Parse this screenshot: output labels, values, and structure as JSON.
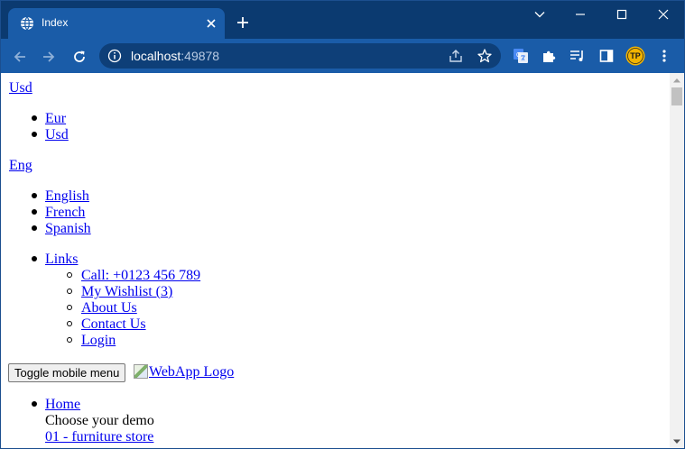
{
  "browser": {
    "tab": {
      "title": "Index",
      "icon": "globe-icon"
    },
    "omnibox": {
      "host": "localhost",
      "port": ":49878"
    },
    "profile_initials": "TP",
    "colors": {
      "frame": "#0b3a70",
      "tab_active": "#1a5ca8",
      "toolbar": "#1a5ca8",
      "omnibox": "#0e3f78",
      "avatar": "#f2b400",
      "link": "#0000ee"
    }
  },
  "page": {
    "currency": {
      "current": "Usd",
      "options": [
        "Eur",
        "Usd"
      ]
    },
    "language": {
      "current": "Eng",
      "options": [
        "English",
        "French",
        "Spanish"
      ]
    },
    "links_menu": {
      "label": "Links",
      "items": [
        "Call: +0123 456 789",
        "My Wishlist (3)",
        "About Us",
        "Contact Us",
        "Login"
      ]
    },
    "toggle_mobile_label": "Toggle mobile menu",
    "logo_alt": "WebApp Logo",
    "nav": {
      "home_label": "Home",
      "demo_heading": "Choose your demo",
      "demo_first": "01 - furniture store"
    }
  }
}
